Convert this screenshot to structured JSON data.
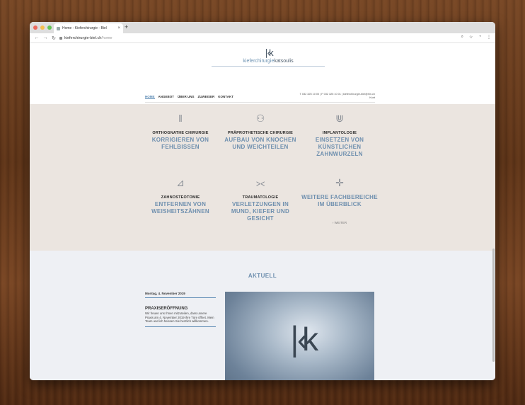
{
  "browser": {
    "tab_title": "Home - Kieferchirurgie - Biel",
    "url_host": "kieferchirurgie-biel.ch",
    "url_path": "/home",
    "traffic_colors": [
      "#ec6a5e",
      "#f4bf4f",
      "#61c554"
    ]
  },
  "header": {
    "logo_mark": "∣‹k",
    "logo_word_a": "kieferchirurgie",
    "logo_word_b": "katsoulis",
    "nav": [
      "HOME",
      "ANGEBOT",
      "ÜBER UNS",
      "ZUWEISER",
      "KONTAKT"
    ],
    "contact_line1": "T 032 325 10 00 | F 032 325 10 01 | kieferchirurgie-biel@hin.ch",
    "contact_line2": "Kont"
  },
  "services": [
    {
      "head": "ORTHOGNATHE CHIRURGIE",
      "sub": "KORRIGIEREN VON FEHLBISSEN",
      "icon": "jaw-alignment-icon"
    },
    {
      "head": "PRÄPROTHETISCHE CHIRURGIE",
      "sub": "AUFBAU VON KNOCHEN UND WEICHTEILEN",
      "icon": "bone-graft-icon"
    },
    {
      "head": "IMPLANTOLOGIE",
      "sub": "EINSETZEN VON KÜNSTLICHEN ZAHNWURZELN",
      "icon": "implant-icon"
    },
    {
      "head": "ZAHNOSTEOTOMIE",
      "sub": "ENTFERNEN VON WEISHEITSZÄHNEN",
      "icon": "tooth-extraction-icon"
    },
    {
      "head": "TRAUMATOLOGIE",
      "sub": "VERLETZUNGEN IN MUND, KIEFER UND GESICHT",
      "icon": "trauma-icon"
    },
    {
      "head": "",
      "sub": "WEITERE FACHBEREICHE IM ÜBERBLICK",
      "icon": "plus-icon",
      "more": "› WEITER"
    }
  ],
  "news": {
    "title": "AKTUELL",
    "date": "Montag, 4. November 2019",
    "post_title": "PRAXISERÖFFNUNG",
    "post_text": "Wir freuen uns Ihnen mitzuteilen, dass unsere Praxis am 4. November 2019 ihre Türe öffnet. Mein Team und ich heissen Sie herzlich willkommen."
  }
}
